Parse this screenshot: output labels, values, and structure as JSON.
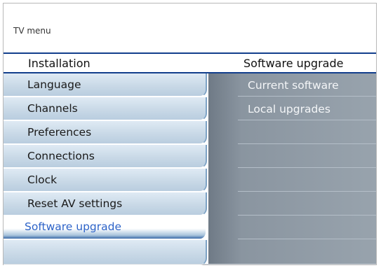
{
  "title": "TV menu",
  "header": {
    "left_label": "Installation",
    "right_label": "Software upgrade"
  },
  "left_menu": {
    "items": [
      {
        "label": "Language",
        "selected": false
      },
      {
        "label": "Channels",
        "selected": false
      },
      {
        "label": "Preferences",
        "selected": false
      },
      {
        "label": "Connections",
        "selected": false
      },
      {
        "label": "Clock",
        "selected": false
      },
      {
        "label": "Reset AV settings",
        "selected": false
      },
      {
        "label": "Software upgrade",
        "selected": true
      }
    ]
  },
  "right_menu": {
    "items": [
      {
        "label": "Current software"
      },
      {
        "label": "Local upgrades"
      }
    ]
  },
  "colors": {
    "header_border": "#123e8c",
    "selected_text": "#2d63c8",
    "left_panel_bg": "#c9d9e7",
    "right_panel_bg": "#8a95a0"
  }
}
